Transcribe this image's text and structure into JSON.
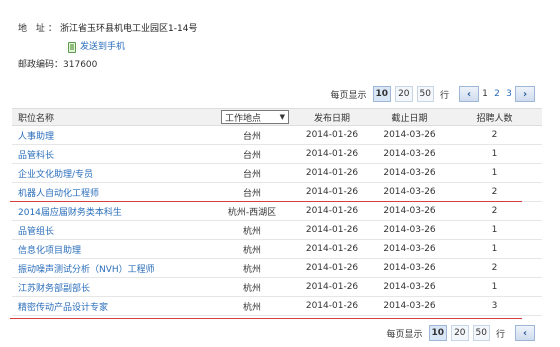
{
  "company": {
    "address_label": "地 址：",
    "address_value": "浙江省玉环县机电工业园区1-14号",
    "send_to_phone": "发送到手机",
    "zip_label": "邮政编码：",
    "zip_value": "317600"
  },
  "pager": {
    "per_page_label": "每页显示",
    "options": [
      "10",
      "20",
      "50"
    ],
    "active_option": "10",
    "unit": "行",
    "prev": "‹",
    "pages": [
      "1",
      "2",
      "3"
    ],
    "current_page": "1"
  },
  "table": {
    "headers": {
      "title": "职位名称",
      "location_select": "工作地点",
      "publish_date": "发布日期",
      "end_date": "截止日期",
      "count": "招聘人数"
    },
    "rows": [
      {
        "title": "人事助理",
        "location": "台州",
        "publish": "2014-01-26",
        "end": "2014-03-26",
        "count": "2"
      },
      {
        "title": "品管科长",
        "location": "台州",
        "publish": "2014-01-26",
        "end": "2014-03-26",
        "count": "1"
      },
      {
        "title": "企业文化助理/专员",
        "location": "台州",
        "publish": "2014-01-26",
        "end": "2014-03-26",
        "count": "1"
      },
      {
        "title": "机器人自动化工程师",
        "location": "台州",
        "publish": "2014-01-26",
        "end": "2014-03-26",
        "count": "2"
      },
      {
        "title": "2014届应届财务类本科生",
        "location": "杭州-西湖区",
        "publish": "2014-01-26",
        "end": "2014-03-26",
        "count": "2"
      },
      {
        "title": "品管组长",
        "location": "杭州",
        "publish": "2014-01-26",
        "end": "2014-03-26",
        "count": "1"
      },
      {
        "title": "信息化项目助理",
        "location": "杭州",
        "publish": "2014-01-26",
        "end": "2014-03-26",
        "count": "1"
      },
      {
        "title": "振动噪声测试分析（NVH）工程师",
        "location": "杭州",
        "publish": "2014-01-26",
        "end": "2014-03-26",
        "count": "2"
      },
      {
        "title": "江苏财务部副部长",
        "location": "杭州",
        "publish": "2014-01-26",
        "end": "2014-03-26",
        "count": "1"
      },
      {
        "title": "精密传动产品设计专家",
        "location": "杭州",
        "publish": "2014-01-26",
        "end": "2014-03-26",
        "count": "3"
      }
    ]
  },
  "colors": {
    "link": "#2a6ebb",
    "header_bg": "#f1f1f1",
    "highlight_line": "#d43f3f"
  }
}
